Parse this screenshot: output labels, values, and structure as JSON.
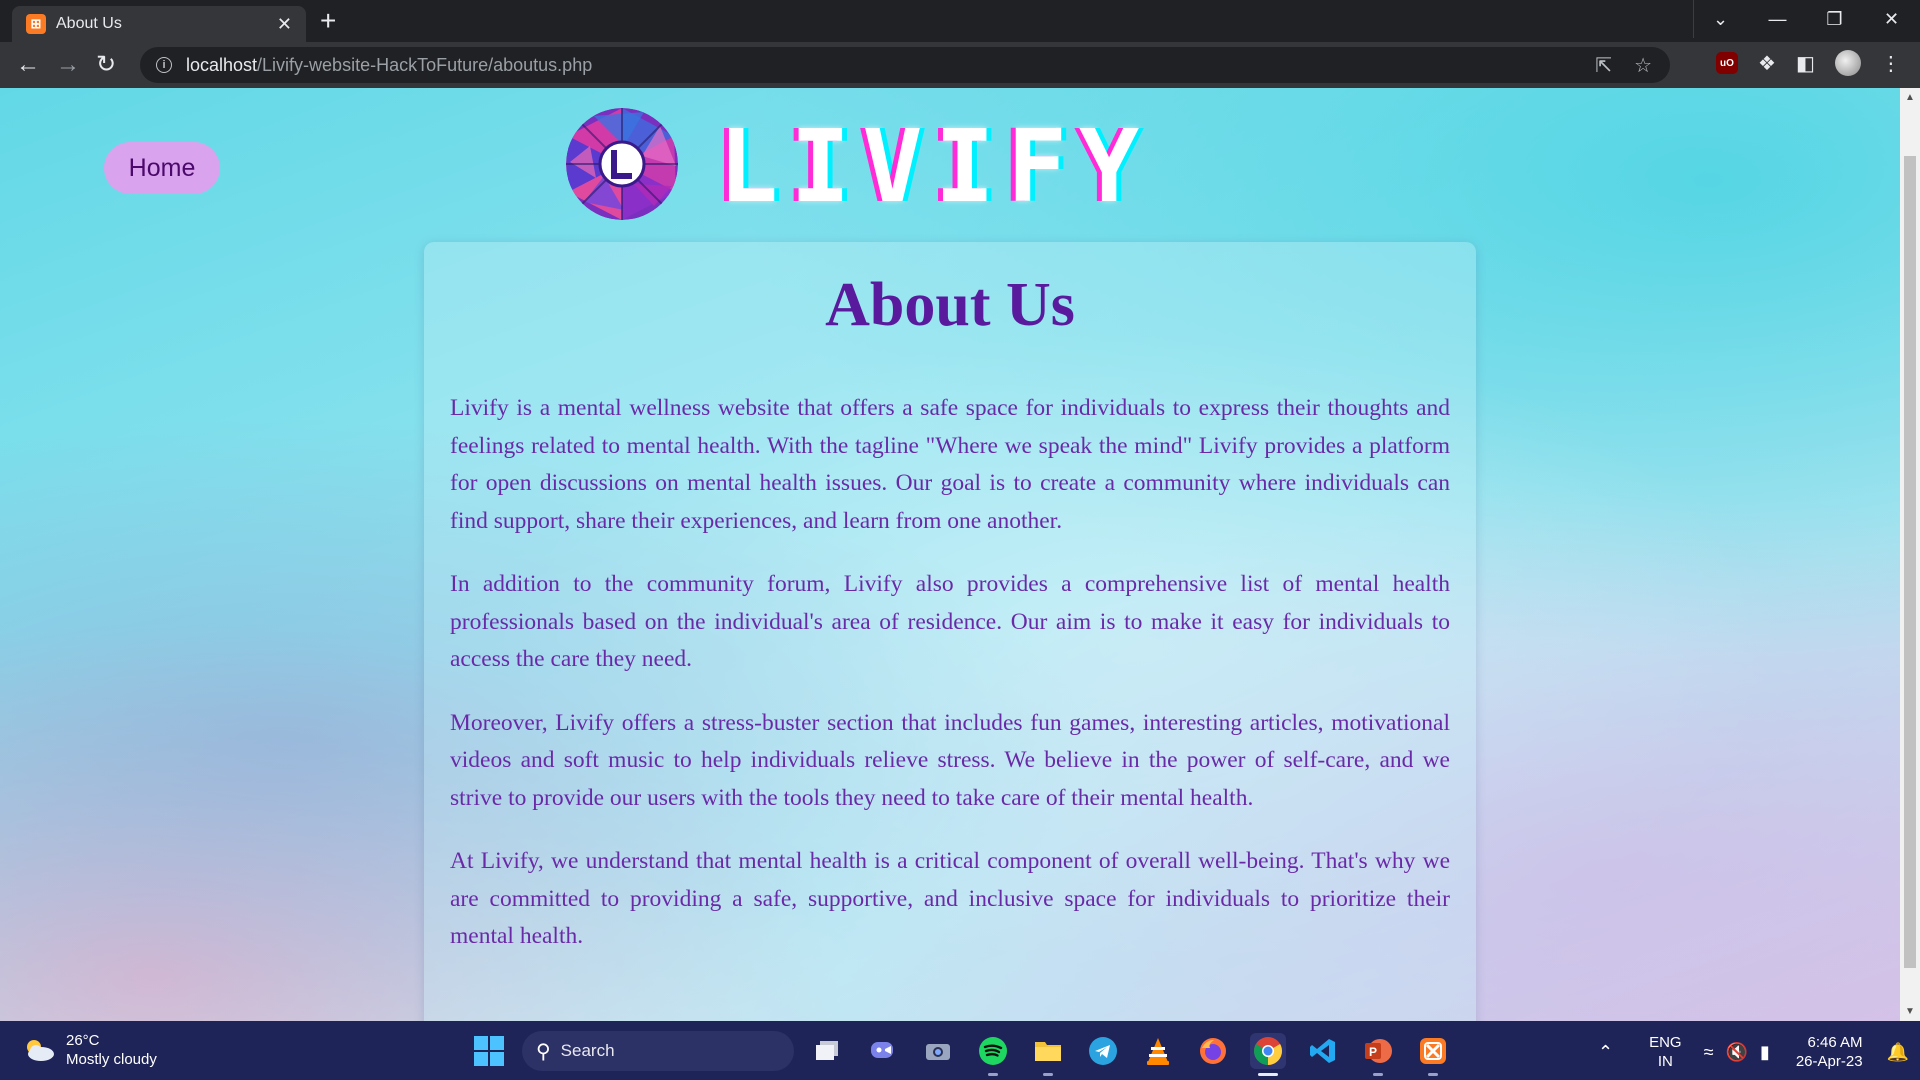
{
  "browser": {
    "tab_title": "About Us",
    "tab_favicon": "xampp-icon",
    "new_tab_label": "+",
    "url_host": "localhost",
    "url_path": "/Livify-website-HackToFuture/aboutus.php"
  },
  "page": {
    "home_label": "Home",
    "logo_text": "LIVIFY",
    "title": "About Us",
    "paragraphs": [
      "Livify is a mental wellness website that offers a safe space for individuals to express their thoughts and feelings related to mental health. With the tagline \"Where we speak the mind\" Livify provides a platform for open discussions on mental health issues. Our goal is to create a community where individuals can find support, share their experiences, and learn from one another.",
      "In addition to the community forum, Livify also provides a comprehensive list of mental health professionals based on the individual's area of residence. Our aim is to make it easy for individuals to access the care they need.",
      "Moreover, Livify offers a stress-buster section that includes fun games, interesting articles, motivational videos and soft music to help individuals relieve stress. We believe in the power of self-care, and we strive to provide our users with the tools they need to take care of their mental health.",
      "At Livify, we understand that mental health is a critical component of overall well-being. That's why we are committed to providing a safe, supportive, and inclusive space for individuals to prioritize their mental health."
    ],
    "colors": {
      "title": "#5a1a9e",
      "text": "#6a2aa8",
      "home_button": "#d9a3ee"
    }
  },
  "taskbar": {
    "weather_temp": "26°C",
    "weather_desc": "Mostly cloudy",
    "search_label": "Search",
    "apps": [
      "task-view-icon",
      "teams-icon",
      "camera-icon",
      "spotify-icon",
      "file-explorer-icon",
      "telegram-icon",
      "vlc-icon",
      "firefox-icon",
      "chrome-icon",
      "vscode-icon",
      "powerpoint-icon",
      "xampp-icon"
    ],
    "lang_line1": "ENG",
    "lang_line2": "IN",
    "time": "6:46 AM",
    "date": "26-Apr-23"
  }
}
